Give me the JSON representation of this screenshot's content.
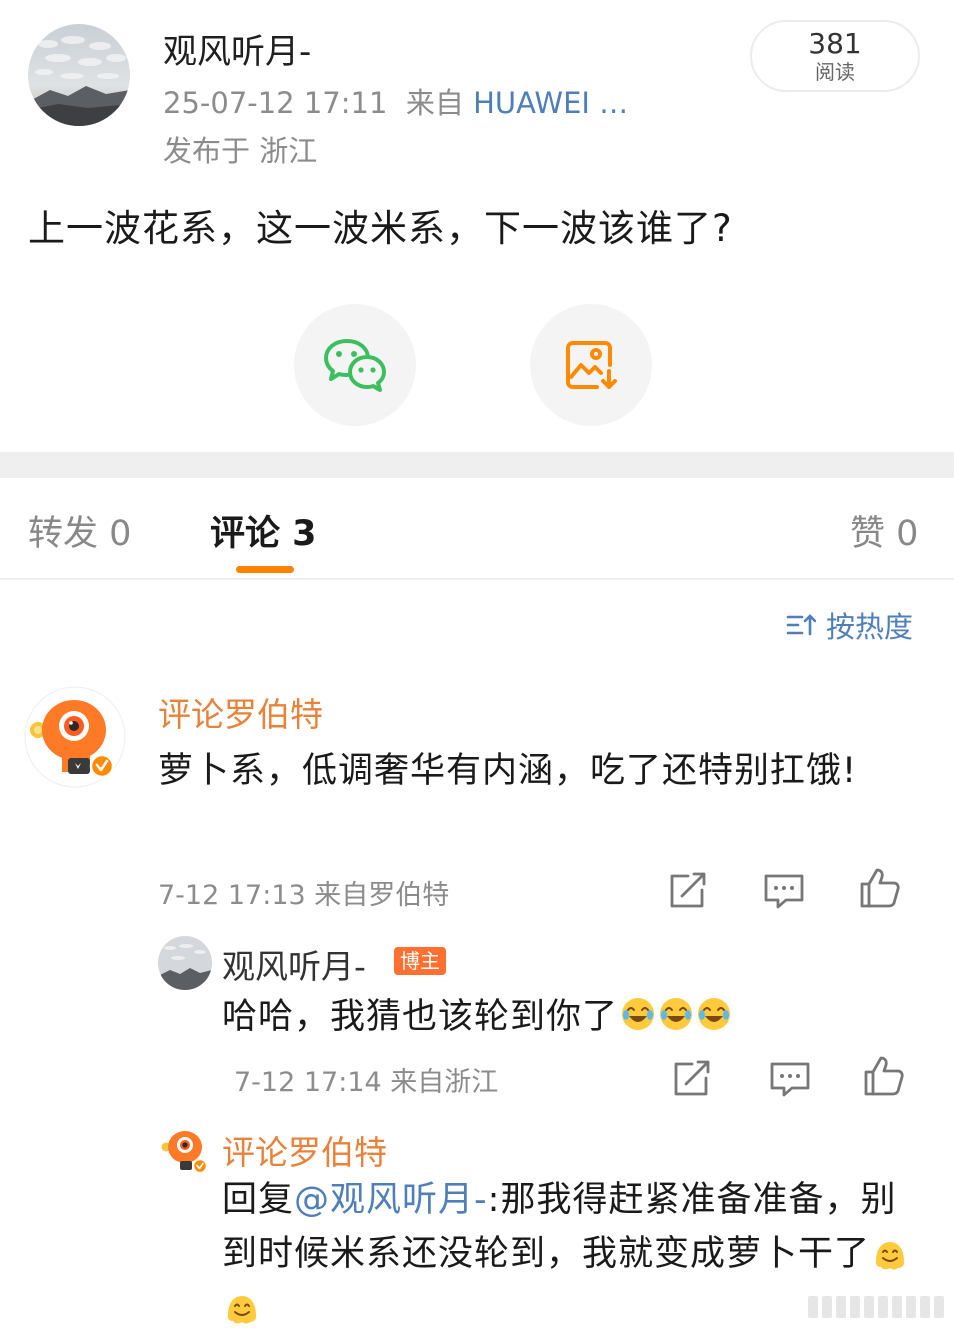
{
  "post": {
    "author": "观风听月-",
    "datetime": "25-07-12 17:11",
    "source_prefix": "来自",
    "device": "HUAWEI …",
    "location": "发布于 浙江",
    "read_count": "381",
    "read_label": "阅读",
    "text": "上一波花系，这一波米系，下一波该谁了?"
  },
  "share": {
    "wechat_icon": "wechat-icon",
    "save_image_icon": "save-image-icon"
  },
  "tabs": {
    "repost": "转发 0",
    "comments": "评论 3",
    "likes": "赞 0",
    "active_color": "#ff8200"
  },
  "sort": {
    "label": "按热度",
    "icon": "sort-icon"
  },
  "comments": [
    {
      "user": "评论罗伯特",
      "text": "萝卜系，低调奢华有内涵，吃了还特别扛饿!",
      "meta": "7-12 17:13 来自罗伯特",
      "replies": [
        {
          "user": "观风听月-",
          "badge": "博主",
          "text": "哈哈，我猜也该轮到你了",
          "emojis": [
            "laugh-cry-emoji",
            "laugh-cry-emoji",
            "laugh-cry-emoji"
          ],
          "meta": "7-12 17:14 来自浙江"
        },
        {
          "user": "评论罗伯特",
          "reply_prefix": "回复",
          "mention": "@观风听月-",
          "text": ":那我得赶紧准备准备，别到时候米系还没轮到，我就变成萝卜干了",
          "emojis": [
            "melting-face-emoji",
            "melting-face-emoji"
          ]
        }
      ]
    }
  ],
  "colors": {
    "link": "#4f7fb8",
    "orange_name": "#e8813a",
    "badge": "#ff6f2f"
  }
}
